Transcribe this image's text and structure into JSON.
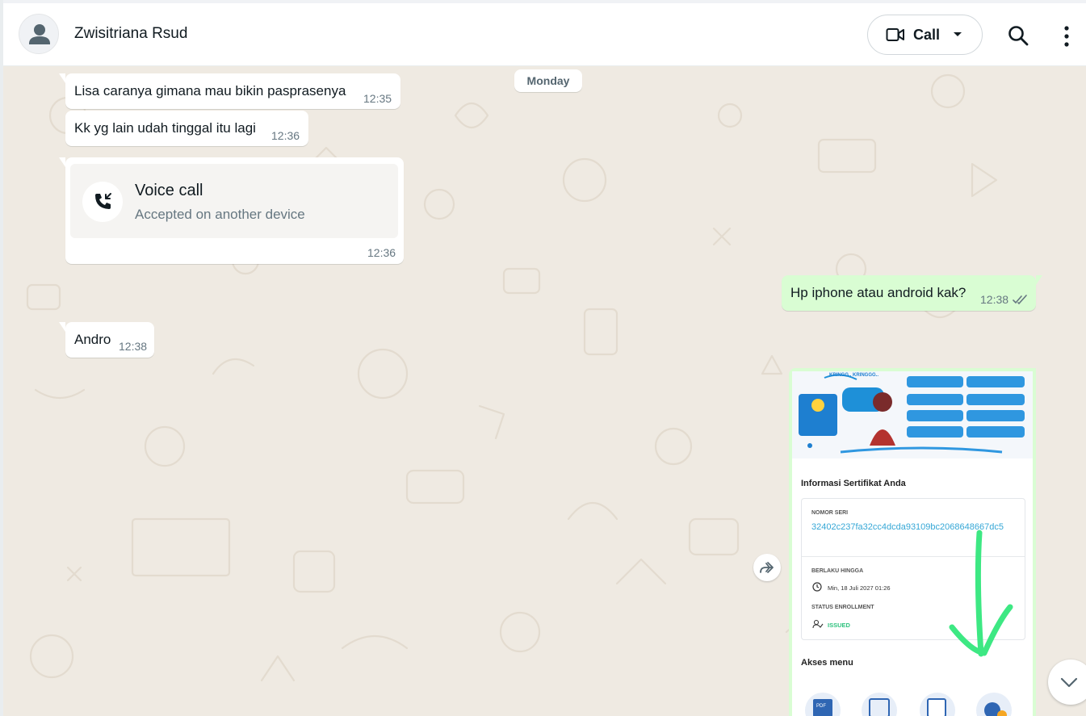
{
  "header": {
    "contact_name": "Zwisitriana Rsud",
    "call_label": "Call"
  },
  "chat": {
    "day_separator": "Monday",
    "messages": [
      {
        "dir": "in",
        "text": "Lisa caranya gimana mau bikin pasprasenya",
        "time": "12:35"
      },
      {
        "dir": "in",
        "text": "Kk yg lain udah tinggal itu lagi",
        "time": "12:36"
      },
      {
        "dir": "in",
        "type": "call",
        "title": "Voice call",
        "subtitle": "Accepted on another device",
        "time": "12:36"
      },
      {
        "dir": "out",
        "text": "Hp iphone atau android kak?",
        "time": "12:38",
        "status": "delivered"
      },
      {
        "dir": "in",
        "text": "Andro",
        "time": "12:38"
      }
    ],
    "image_message": {
      "cert_heading": "Informasi Sertifikat Anda",
      "nomor_label": "NOMOR SERI",
      "nomor_value": "32402c237fa32cc4dcda93109bc2068648667dc5",
      "berlaku_label": "BERLAKU HINGGA",
      "berlaku_value": "Min, 18 Juli 2027 01:26",
      "status_label": "STATUS ENROLLMENT",
      "status_value": "ISSUED",
      "akses_heading": "Akses menu",
      "banner_text": "KRINGG.. KRINGGG..",
      "file_icon_label": "PDF"
    }
  },
  "colors": {
    "chat_bg": "#efeae2",
    "incoming_bubble": "#ffffff",
    "outgoing_bubble": "#d9fdd3",
    "tick_color": "#667781",
    "annotation_green": "#3de883",
    "link_blue": "#35a7d6"
  },
  "icons": [
    "person-icon",
    "video-camera-icon",
    "chevron-down-icon",
    "search-icon",
    "more-vertical-icon",
    "phone-incoming-icon",
    "forward-icon",
    "double-check-icon",
    "scroll-down-chevron-icon"
  ]
}
